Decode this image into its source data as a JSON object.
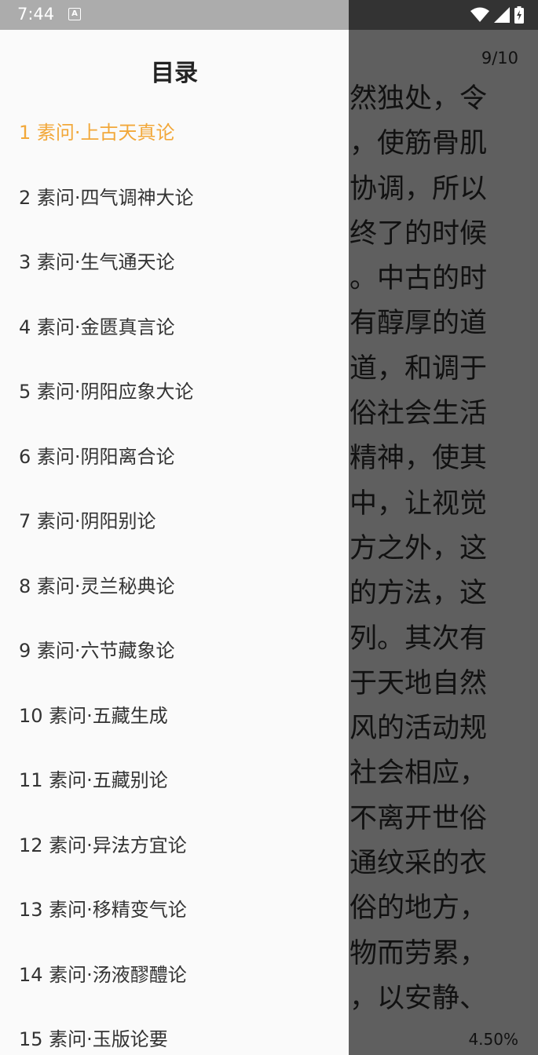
{
  "status_bar": {
    "time": "7:44",
    "notification_icon_letter": "A",
    "icons": [
      "wifi-icon",
      "signal-icon",
      "battery-charging-icon"
    ]
  },
  "drawer": {
    "title": "目录",
    "active_index": 0,
    "accent_color": "#f2a83a",
    "items": [
      {
        "label": "1 素问·上古天真论"
      },
      {
        "label": "2 素问·四气调神大论"
      },
      {
        "label": "3 素问·生气通天论"
      },
      {
        "label": "4 素问·金匮真言论"
      },
      {
        "label": "5 素问·阴阳应象大论"
      },
      {
        "label": "6 素问·阴阳离合论"
      },
      {
        "label": "7 素问·阴阳别论"
      },
      {
        "label": "8 素问·灵兰秘典论"
      },
      {
        "label": "9 素问·六节藏象论"
      },
      {
        "label": "10 素问·五藏生成"
      },
      {
        "label": "11 素问·五藏别论"
      },
      {
        "label": "12 素问·异法方宜论"
      },
      {
        "label": "13 素问·移精变气论"
      },
      {
        "label": "14 素问·汤液醪醴论"
      },
      {
        "label": "15 素问·玉版论要"
      }
    ]
  },
  "reader": {
    "page_indicator": "9/10",
    "progress": "4.50%",
    "lines": [
      "然独处，令",
      "，使筋骨肌",
      "协调，所以",
      "终了的时候",
      "。中古的时",
      "有醇厚的道",
      "道，和调于",
      "俗社会生活",
      "精神，使其",
      "中，让视觉",
      "方之外，这",
      "的方法，这",
      "列。其次有",
      "于天地自然",
      "风的活动规",
      "社会相应，",
      "不离开世俗",
      "通纹采的衣",
      "俗的地方，",
      "物而劳累，",
      "，以安静、"
    ]
  }
}
